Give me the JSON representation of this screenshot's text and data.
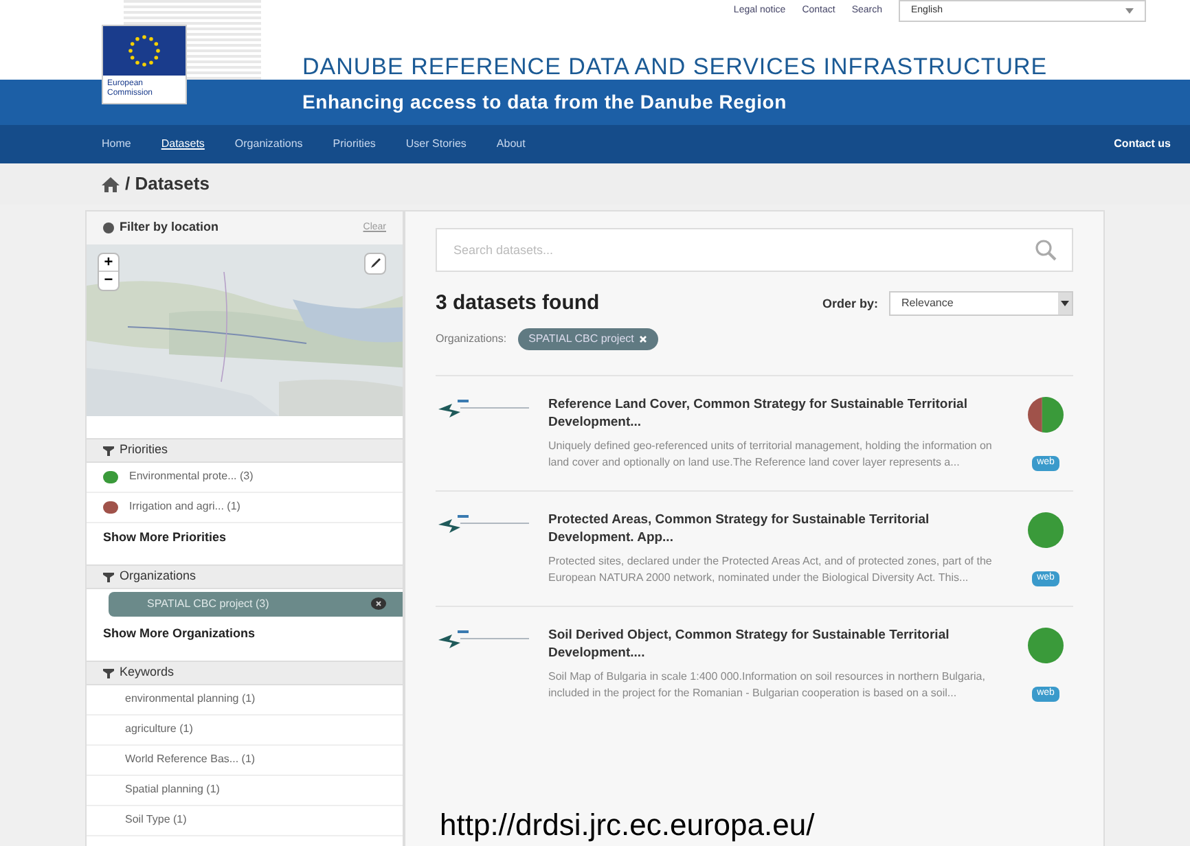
{
  "top_links": [
    "Legal notice",
    "Contact",
    "Search"
  ],
  "language": {
    "value": "English"
  },
  "logo": {
    "caption": "European Commission"
  },
  "site_title": "DANUBE REFERENCE DATA AND SERVICES INFRASTRUCTURE",
  "tagline": "Enhancing access to data from the Danube Region",
  "nav": {
    "items": [
      {
        "label": "Home",
        "selected": false
      },
      {
        "label": "Datasets",
        "selected": true
      },
      {
        "label": "Organizations",
        "selected": false
      },
      {
        "label": "Priorities",
        "selected": false
      },
      {
        "label": "User Stories",
        "selected": false
      },
      {
        "label": "About",
        "selected": false
      }
    ],
    "contact": "Contact us"
  },
  "breadcrumb": "/ Datasets",
  "sidebar": {
    "location": {
      "title": "Filter by location",
      "clear": "Clear",
      "zoom_in": "+",
      "zoom_out": "−"
    },
    "facets": [
      {
        "title": "Priorities",
        "items": [
          {
            "label": "Environmental prote... (3)",
            "color": "#3a9a3a",
            "selected": false
          },
          {
            "label": "Irrigation and agri... (1)",
            "color": "#a0524a",
            "selected": false
          }
        ],
        "more": "Show More Priorities"
      },
      {
        "title": "Organizations",
        "items": [
          {
            "label": "SPATIAL CBC project (3)",
            "selected": true
          }
        ],
        "more": "Show More Organizations"
      },
      {
        "title": "Keywords",
        "items": [
          {
            "label": "environmental planning (1)",
            "selected": false
          },
          {
            "label": "agriculture (1)",
            "selected": false
          },
          {
            "label": "World Reference Bas... (1)",
            "selected": false
          },
          {
            "label": "Spatial planning (1)",
            "selected": false
          },
          {
            "label": "Soil Type (1)",
            "selected": false
          }
        ]
      }
    ]
  },
  "search": {
    "placeholder": "Search datasets..."
  },
  "results_count": "3 datasets found",
  "order_by": {
    "label": "Order by:",
    "value": "Relevance"
  },
  "active_filter": {
    "label": "Organizations:",
    "value": "SPATIAL CBC project"
  },
  "datasets": [
    {
      "title": "Reference Land Cover, Common Strategy for Sustainable Territorial Development...",
      "description": "Uniquely defined geo-referenced units of territorial management, holding the information on land cover and optionally on land use.The Reference land cover layer represents a...",
      "format": "web",
      "priorities": [
        {
          "color": "#a0524a",
          "level": 0.4
        },
        {
          "color": "#3a9a3a",
          "level": 0.6
        }
      ]
    },
    {
      "title": "Protected Areas, Common Strategy for Sustainable Territorial Development. App...",
      "description": "Protected sites, declared under the Protected Areas Act, and of protected zones, part of the European NATURA 2000 network, nominated under the Biological Diversity Act. This...",
      "format": "web",
      "priorities": [
        {
          "color": "#3a9a3a",
          "level": 1
        }
      ]
    },
    {
      "title": "Soil Derived Object, Common Strategy for Sustainable Territorial Development....",
      "description": "Soil Map of Bulgaria in scale 1:400 000.Information on soil resources in northern Bulgaria, included in the project for the Romanian - Bulgarian cooperation is based on a soil...",
      "format": "web",
      "priorities": [
        {
          "color": "#3a9a3a",
          "level": 1
        }
      ]
    }
  ],
  "caption": "http://drdsi.jrc.ec.europa.eu/"
}
